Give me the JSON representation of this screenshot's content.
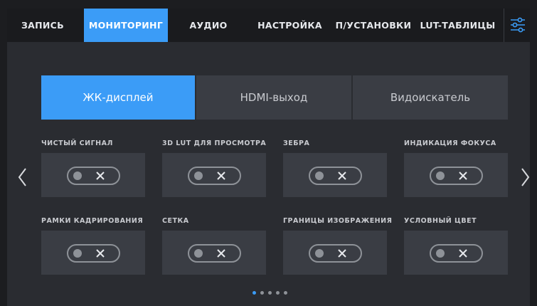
{
  "tabs": [
    {
      "label": "ЗАПИСЬ",
      "active": false
    },
    {
      "label": "МОНИТОРИНГ",
      "active": true
    },
    {
      "label": "АУДИО",
      "active": false
    },
    {
      "label": "НАСТРОЙКА",
      "active": false
    },
    {
      "label": "П/УСТАНОВКИ",
      "active": false
    },
    {
      "label": "LUT-ТАБЛИЦЫ",
      "active": false
    }
  ],
  "menu_icon": "sliders-icon",
  "outputs": [
    {
      "label": "ЖК-дисплей",
      "active": true
    },
    {
      "label": "HDMI-выход",
      "active": false
    },
    {
      "label": "Видоискатель",
      "active": false
    }
  ],
  "settings": [
    {
      "label": "ЧИСТЫЙ СИГНАЛ",
      "enabled": false
    },
    {
      "label": "3D LUT ДЛЯ ПРОСМОТРА",
      "enabled": false
    },
    {
      "label": "ЗЕБРА",
      "enabled": false
    },
    {
      "label": "ИНДИКАЦИЯ ФОКУСА",
      "enabled": false
    },
    {
      "label": "РАМКИ КАДРИРОВАНИЯ",
      "enabled": false
    },
    {
      "label": "СЕТКА",
      "enabled": false
    },
    {
      "label": "ГРАНИЦЫ ИЗОБРАЖЕНИЯ",
      "enabled": false
    },
    {
      "label": "УСЛОВНЫЙ ЦВЕТ",
      "enabled": false
    }
  ],
  "pagination": {
    "pages": 5,
    "current": 1
  },
  "colors": {
    "accent": "#3b9cf7",
    "panel": "#3a3d44",
    "background": "#2a2c31",
    "topbar": "#1a1b1e"
  }
}
